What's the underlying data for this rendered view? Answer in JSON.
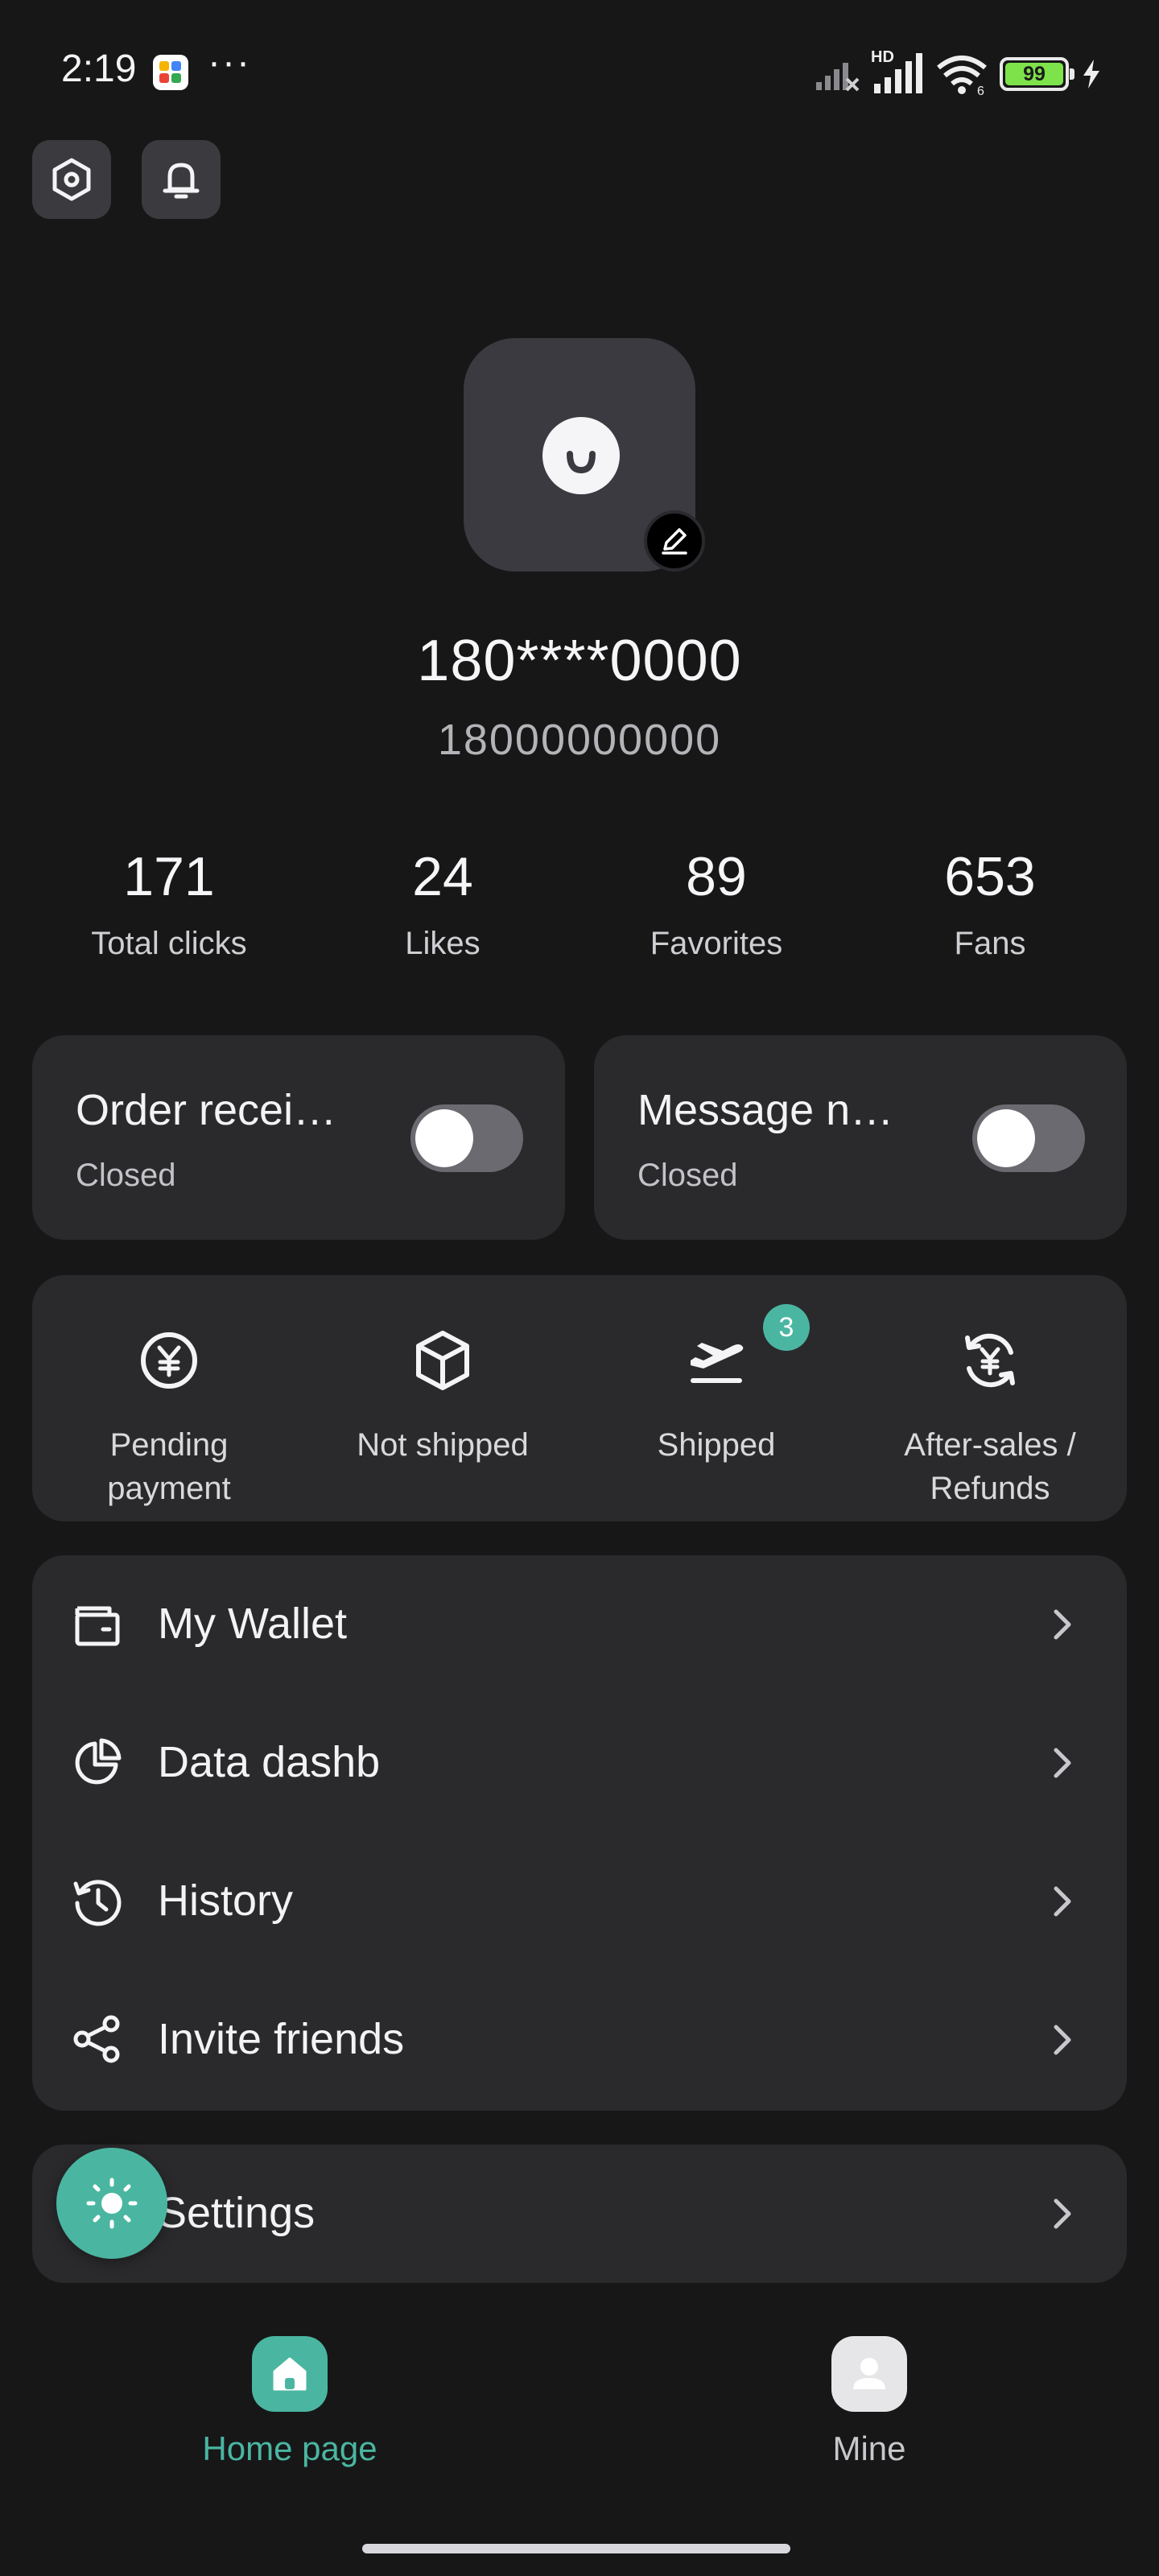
{
  "status_bar": {
    "time": "2:19",
    "more": "···",
    "network_label": "HD",
    "battery_level": "99",
    "icons": [
      "app-notification-icon",
      "signal-off-icon",
      "signal-icon",
      "wifi-icon",
      "battery-icon",
      "charging-icon"
    ]
  },
  "top_actions": {
    "icons": [
      "settings-hex-icon",
      "bell-icon"
    ]
  },
  "profile": {
    "name": "180****0000",
    "phone": "18000000000"
  },
  "stats": [
    {
      "value": "171",
      "label": "Total clicks"
    },
    {
      "value": "24",
      "label": "Likes"
    },
    {
      "value": "89",
      "label": "Favorites"
    },
    {
      "value": "653",
      "label": "Fans"
    }
  ],
  "toggles": [
    {
      "title": "Order recei…",
      "status": "Closed",
      "on": false
    },
    {
      "title": "Message n…",
      "status": "Closed",
      "on": false
    }
  ],
  "orders": [
    {
      "label": "Pending payment",
      "icon": "yen-circle-icon"
    },
    {
      "label": "Not shipped",
      "icon": "box-icon"
    },
    {
      "label": "Shipped",
      "icon": "plane-takeoff-icon",
      "badge": "3"
    },
    {
      "label": "After-sales / Refunds",
      "icon": "yen-refresh-icon"
    }
  ],
  "menu": [
    {
      "label": "My Wallet",
      "icon": "wallet-icon"
    },
    {
      "label": "Data dashb",
      "icon": "pie-chart-icon"
    },
    {
      "label": "History",
      "icon": "history-icon"
    },
    {
      "label": "Invite friends",
      "icon": "share-icon"
    }
  ],
  "settings": {
    "label": "Settings"
  },
  "nav": [
    {
      "label": "Home page",
      "active": true
    },
    {
      "label": "Mine",
      "active": false
    }
  ],
  "colors": {
    "background": "#171718",
    "card": "#2a2a2d",
    "accent": "#4ab6a1",
    "battery": "#7ee34b"
  }
}
